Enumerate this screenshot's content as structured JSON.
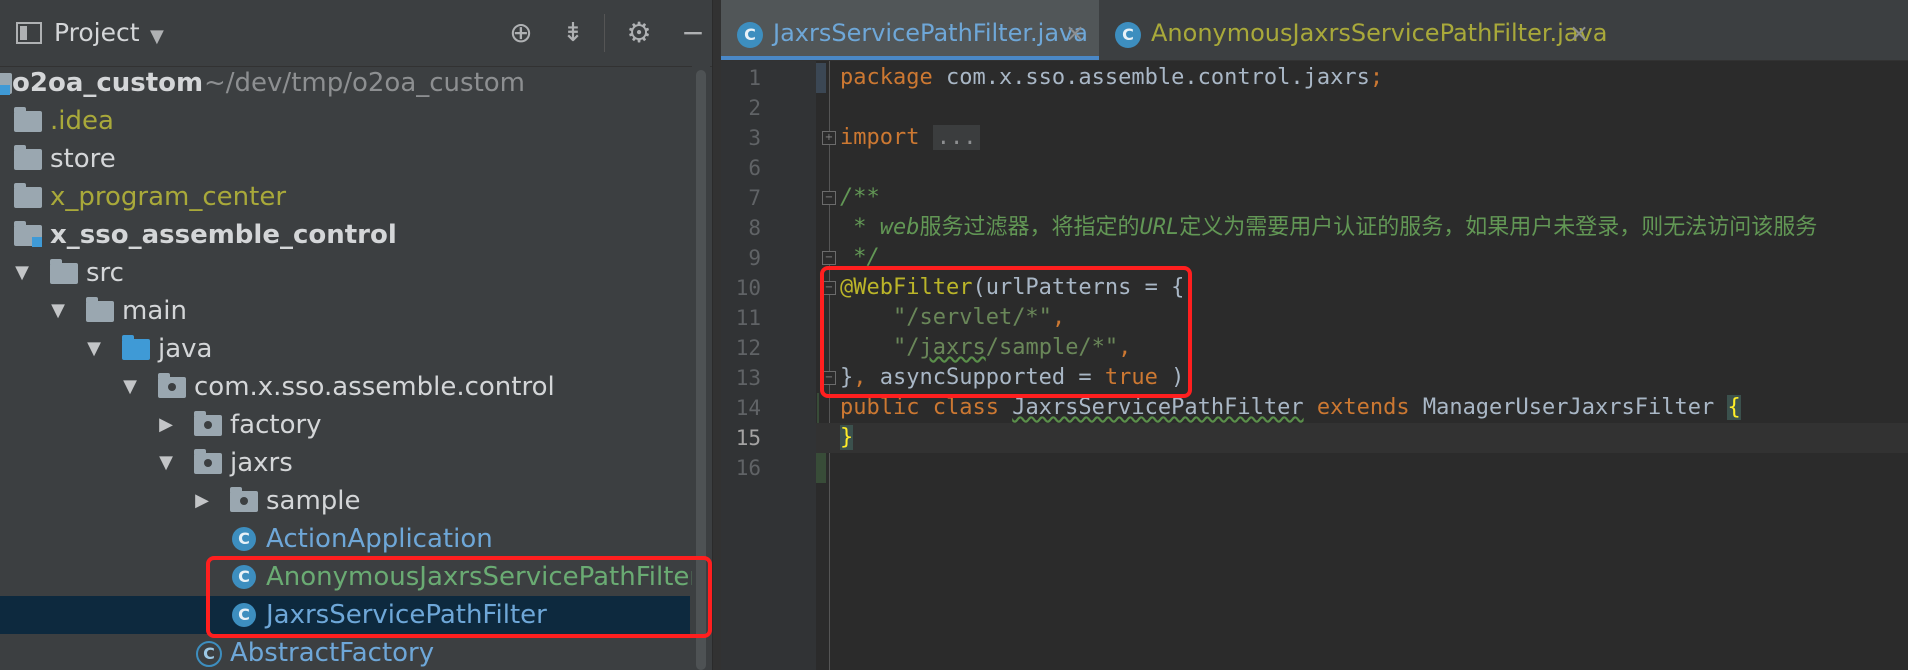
{
  "project_panel": {
    "title": "Project",
    "tree": [
      {
        "label": "o2oa_custom",
        "suffix": "~/dev/tmp/o2oa_custom"
      },
      {
        "label": ".idea"
      },
      {
        "label": "store"
      },
      {
        "label": "x_program_center"
      },
      {
        "label": "x_sso_assemble_control"
      },
      {
        "label": "src"
      },
      {
        "label": "main"
      },
      {
        "label": "java"
      },
      {
        "label": "com.x.sso.assemble.control"
      },
      {
        "label": "factory"
      },
      {
        "label": "jaxrs"
      },
      {
        "label": "sample"
      },
      {
        "label": "ActionApplication"
      },
      {
        "label": "AnonymousJaxrsServicePathFilter"
      },
      {
        "label": "JaxrsServicePathFilter"
      },
      {
        "label": "AbstractFactory"
      }
    ],
    "class_icon_letter": "C"
  },
  "editor": {
    "tabs": [
      {
        "label": "JaxrsServicePathFilter.java",
        "active": true
      },
      {
        "label": "AnonymousJaxrsServicePathFilter.java",
        "active": false
      }
    ],
    "close_glyph": "×",
    "line_numbers": [
      "1",
      "2",
      "3",
      "6",
      "7",
      "8",
      "9",
      "10",
      "11",
      "12",
      "13",
      "14",
      "15",
      "16"
    ],
    "code": {
      "l1_kw": "package",
      "l1_rest": " com.x.sso.assemble.control.jaxrs",
      "l1_semi": ";",
      "l3_kw": "import",
      "l3_dots": "...",
      "l7": "/**",
      "l8_star": " * ",
      "l8_a": "web",
      "l8_b": "服务过滤器，将指定的",
      "l8_c": "URL",
      "l8_d": "定义为需要用户认证的服务，如果用户未登录，则无法访问该服务",
      "l9": " */",
      "l10_ann": "@WebFilter",
      "l10_rest": "(urlPatterns = {",
      "l11_indent": "    ",
      "l11_str": "\"/servlet/*\"",
      "l11_comma": ",",
      "l12_indent": "    ",
      "l12_str_a": "\"/",
      "l12_str_b": "jaxrs",
      "l12_str_c": "/sample/*\"",
      "l12_comma": ",",
      "l13_a": "}",
      "l13_comma": ",",
      "l13_b": " asyncSupported = ",
      "l13_true": "true",
      "l13_c": " )",
      "l14_public": "public",
      "l14_class": " class ",
      "l14_name": "JaxrsServicePathFilter",
      "l14_extends": " extends ",
      "l14_parent": "ManagerUserJaxrsFilter ",
      "l14_brace": "{",
      "l15_brace": "}"
    }
  }
}
